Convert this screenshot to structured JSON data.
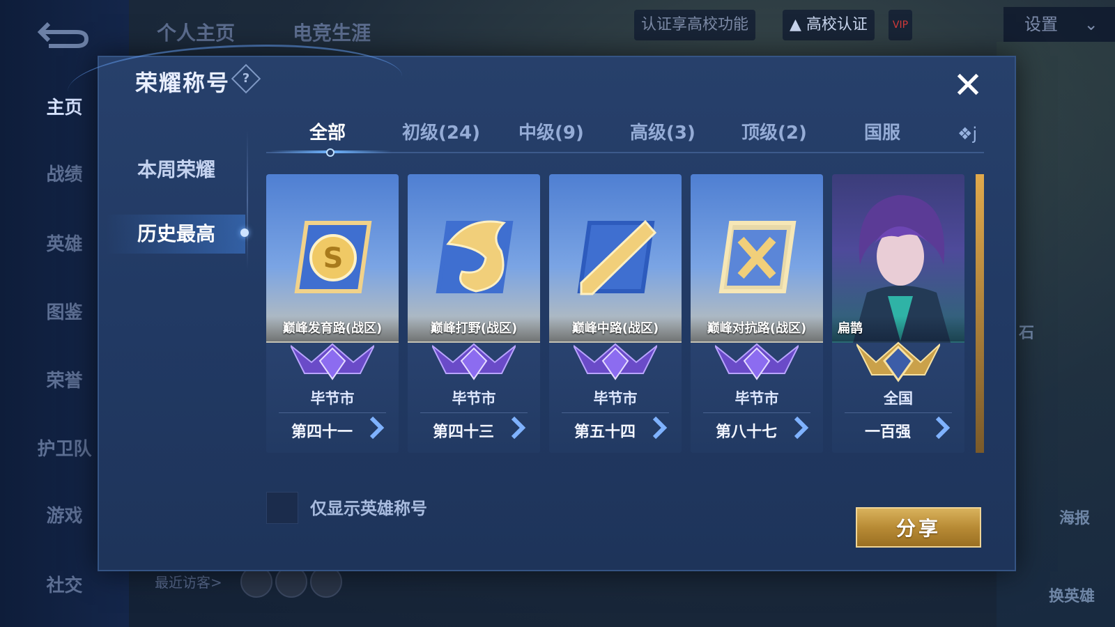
{
  "background": {
    "top_tabs": [
      "个人主页",
      "电竞生涯"
    ],
    "campus_prompt": "认证享高校功能",
    "campus_cert": "高校认证",
    "vip_label": "VIP",
    "settings": "设置",
    "nav_items": [
      "主页",
      "战绩",
      "英雄",
      "图鉴",
      "荣誉",
      "护卫队",
      "游戏",
      "社交"
    ],
    "recent_visitors": "最近访客>",
    "side_labels": [
      "海报",
      "换英雄",
      "石"
    ]
  },
  "modal": {
    "title": "荣耀称号",
    "side_menu": [
      "本周荣耀",
      "历史最高"
    ],
    "selected_side": "历史最高",
    "tabs": [
      "全部",
      "初级(24)",
      "中级(9)",
      "高级(3)",
      "顶级(2)",
      "国服"
    ],
    "active_tab": "全部",
    "more_tab_partial": "❖j",
    "cards": [
      {
        "name": "巅峰发育路(战区)",
        "region": "毕节市",
        "rank": "第四十一",
        "emblem": "s-coin-icon"
      },
      {
        "name": "巅峰打野(战区)",
        "region": "毕节市",
        "rank": "第四十三",
        "emblem": "dragon-icon"
      },
      {
        "name": "巅峰中路(战区)",
        "region": "毕节市",
        "rank": "第五十四",
        "emblem": "slash-icon"
      },
      {
        "name": "巅峰对抗路(战区)",
        "region": "毕节市",
        "rank": "第八十七",
        "emblem": "crossed-swords-icon"
      },
      {
        "name": "扁鹊",
        "region": "全国",
        "rank": "一百强",
        "emblem": "hero-portrait"
      }
    ],
    "checkbox_label": "仅显示英雄称号",
    "checkbox_checked": false,
    "share_button": "分享"
  },
  "colors": {
    "accent_gold": "#d9b25c",
    "badge_purple": "#7a5ad6",
    "modal_bg": "#223a63"
  }
}
